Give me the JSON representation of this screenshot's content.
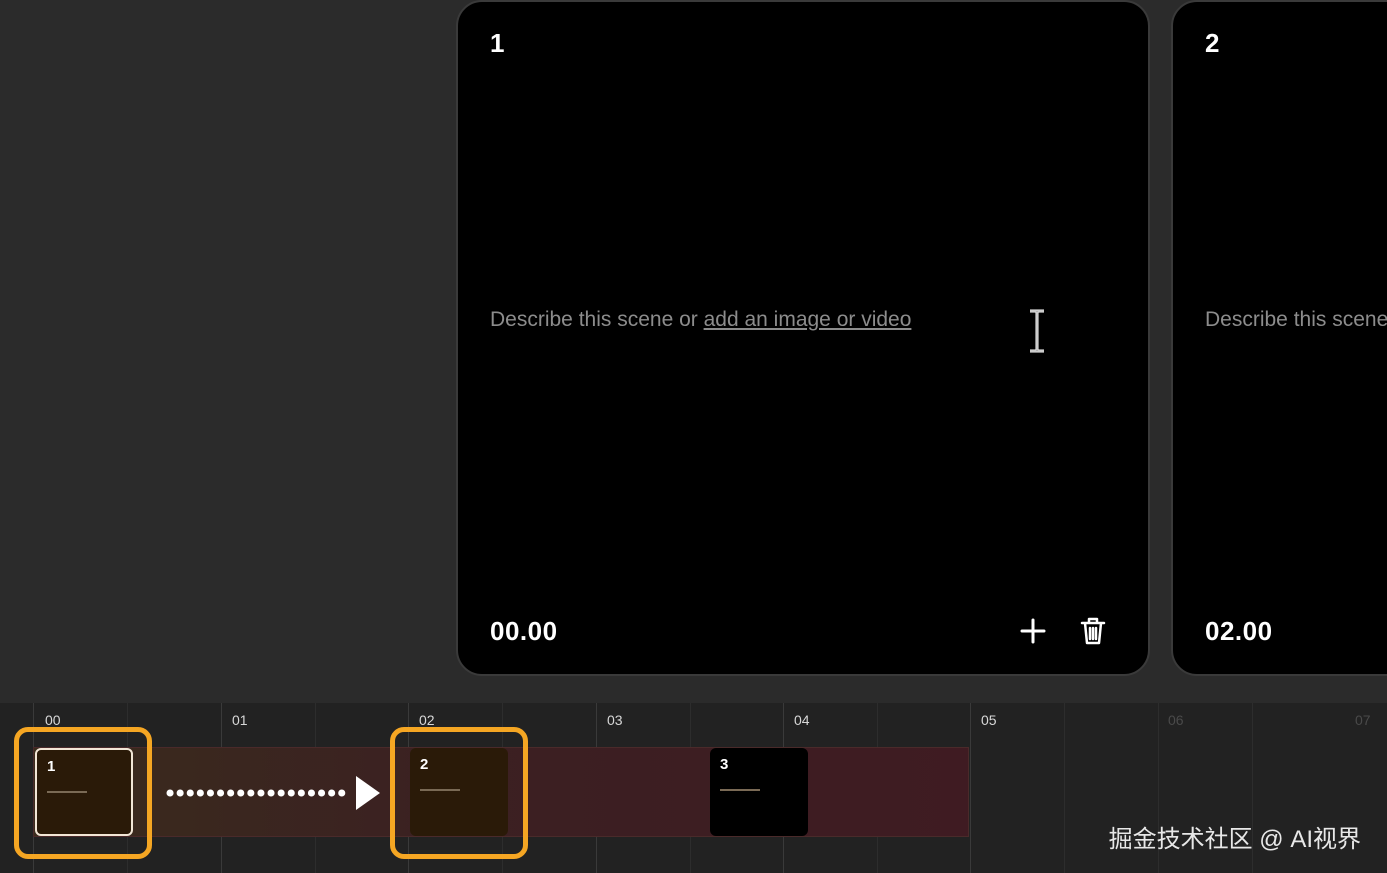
{
  "scenes": [
    {
      "number": "1",
      "prompt_text": "Describe this scene or ",
      "prompt_link": "add an image or video",
      "time": "00.00"
    },
    {
      "number": "2",
      "prompt_text": "Describe this scene",
      "time": "02.00"
    }
  ],
  "timeline": {
    "ticks": [
      "00",
      "01",
      "02",
      "03",
      "04",
      "05",
      "06",
      "07"
    ],
    "clips": [
      {
        "number": "1"
      },
      {
        "number": "2"
      },
      {
        "number": "3"
      }
    ]
  },
  "watermark": "掘金技术社区 @ AI视界",
  "colors": {
    "highlight": "#f5a623",
    "card_bg": "#000000",
    "page_bg": "#2b2b2b"
  },
  "icons": [
    "add-icon",
    "trash-icon",
    "text-cursor-icon",
    "arrow-icon"
  ]
}
